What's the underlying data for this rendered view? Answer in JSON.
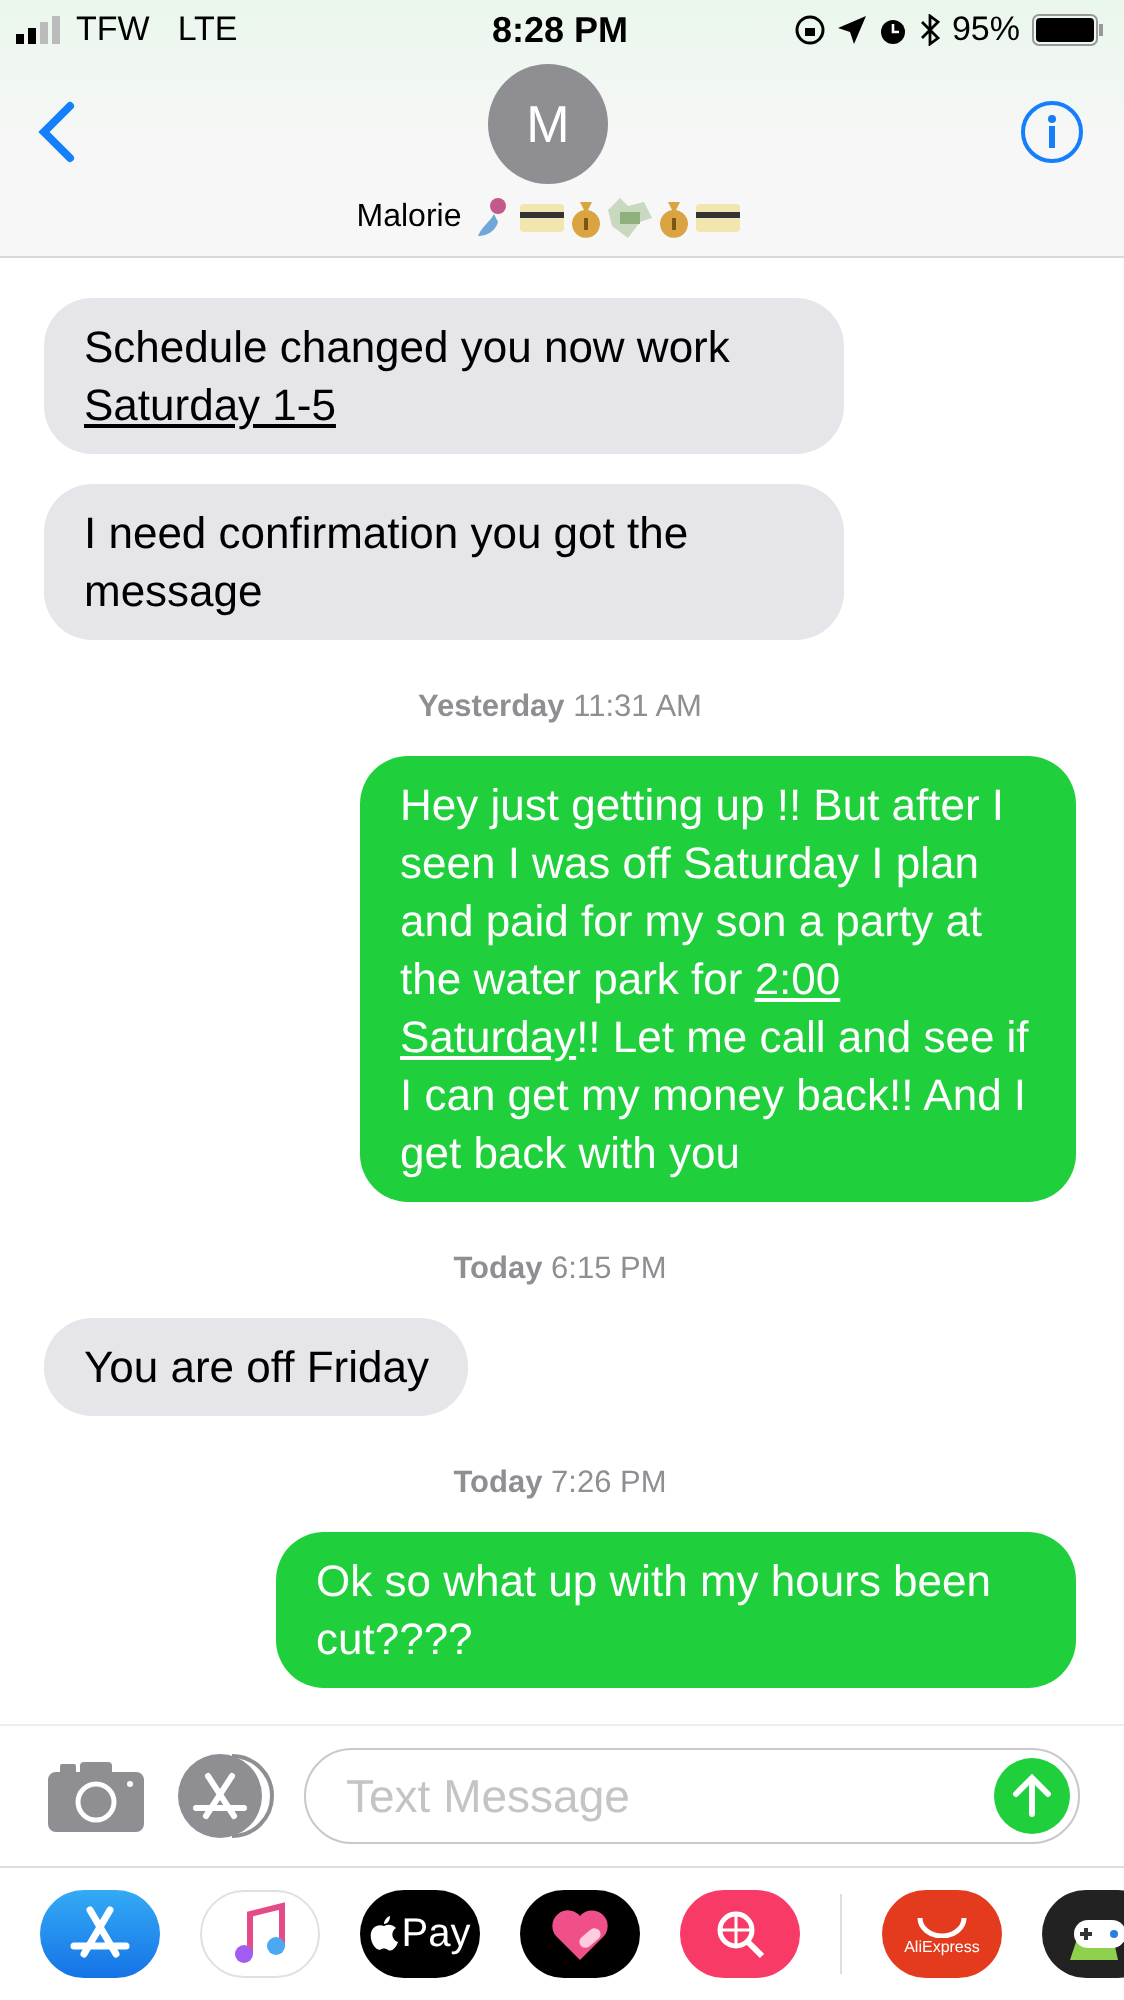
{
  "status_bar": {
    "carrier": "TFW",
    "network": "LTE",
    "time": "8:28 PM",
    "battery": "95%"
  },
  "header": {
    "avatar_initial": "M",
    "contact_name": "Malorie"
  },
  "thread": [
    {
      "kind": "received",
      "parts": [
        {
          "text": "Schedule changed you now work ",
          "link": false
        },
        {
          "text": "Saturday 1-5",
          "link": true
        }
      ]
    },
    {
      "kind": "received",
      "parts": [
        {
          "text": "I need confirmation you got the message",
          "link": false
        }
      ]
    },
    {
      "kind": "timestamp",
      "text": "**Yesterday** 11:31 AM"
    },
    {
      "kind": "sent",
      "parts": [
        {
          "text": "Hey just getting up !! But after I seen I was off Saturday I plan and paid for my son a party at the water park  for ",
          "link": false
        },
        {
          "text": "2:00 Saturday",
          "link": true
        },
        {
          "text": "!! Let me call and see if I can get my money back!! And I get back with you",
          "link": false
        }
      ]
    },
    {
      "kind": "timestamp",
      "text": "**Today** 6:15 PM"
    },
    {
      "kind": "received",
      "parts": [
        {
          "text": "You are off Friday",
          "link": false
        }
      ]
    },
    {
      "kind": "timestamp",
      "text": "**Today** 7:26 PM"
    },
    {
      "kind": "sent",
      "parts": [
        {
          "text": "Ok so what up with my hours been cut????",
          "link": false
        }
      ]
    }
  ],
  "composer": {
    "placeholder": "Text Message"
  },
  "app_strip": [
    {
      "kind": "appstore"
    },
    {
      "kind": "music"
    },
    {
      "kind": "pay",
      "label": "Pay"
    },
    {
      "kind": "heart"
    },
    {
      "kind": "search"
    },
    {
      "kind": "divider"
    },
    {
      "kind": "aliexpress",
      "label": "AliExpress"
    },
    {
      "kind": "game"
    }
  ]
}
